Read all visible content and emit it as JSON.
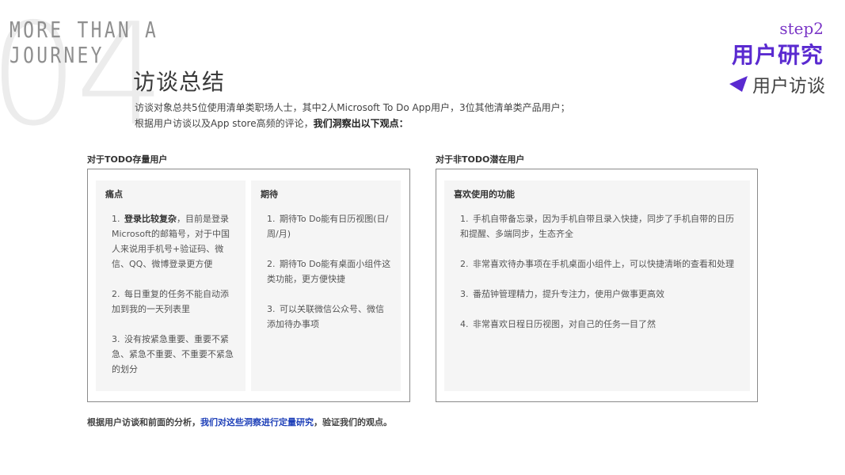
{
  "background": {
    "number": "04",
    "journey_line1": "MORE THAN A",
    "journey_line2": "JOURNEY"
  },
  "header": {
    "title": "访谈总结",
    "intro_line1": "访谈对象总共5位使用清单类职场人士，其中2人Microsoft To Do App用户，3位其他清单类产品用户；",
    "intro_line2_normal": "根据用户访谈以及App store高频的评论，",
    "intro_line2_bold": "我们洞察出以下观点："
  },
  "badge": {
    "step": "step2",
    "section": "用户研究",
    "subsection": "用户访谈",
    "accent_color": "#5a2ad0",
    "icon": "triangle-pointer-icon"
  },
  "existing_users": {
    "label": "对于TODO存量用户",
    "pain": {
      "title": "痛点",
      "items": [
        {
          "num": "1.",
          "bold": "登录比较复杂",
          "text": "，目前是登录Microsoft的邮箱号，对于中国人来说用手机号+验证码、微信、QQ、微博登录更方便"
        },
        {
          "num": "2.",
          "bold": "",
          "text": "每日重复的任务不能自动添加到我的一天列表里"
        },
        {
          "num": "3.",
          "bold": "",
          "text": "没有按紧急重要、重要不紧急、紧急不重要、不重要不紧急的划分"
        }
      ]
    },
    "expect": {
      "title": "期待",
      "items": [
        {
          "num": "1.",
          "text": "期待To Do能有日历视图(日/周/月)"
        },
        {
          "num": "2.",
          "text": "期待To Do能有桌面小组件这类功能，更方便快捷"
        },
        {
          "num": "3.",
          "text": "可以关联微信公众号、微信添加待办事项"
        }
      ]
    }
  },
  "potential_users": {
    "label": "对于非TODO潜在用户",
    "likes": {
      "title": "喜欢使用的功能",
      "items": [
        {
          "num": "1.",
          "text": "手机自带备忘录，因为手机自带且录入快捷，同步了手机自带的日历和提醒、多端同步，生态齐全"
        },
        {
          "num": "2.",
          "text": "非常喜欢待办事项在手机桌面小组件上，可以快捷清晰的查看和处理"
        },
        {
          "num": "3.",
          "text": "番茄钟管理精力，提升专注力，使用户做事更高效"
        },
        {
          "num": "4.",
          "text": "非常喜欢日程日历视图，对自己的任务一目了然"
        }
      ]
    }
  },
  "footer": {
    "part1": "根据用户访谈和前面的分析，",
    "highlight": "我们对这些洞察进行定量研究",
    "part2": "，验证我们的观点。",
    "highlight_color": "#1d3fb8"
  }
}
